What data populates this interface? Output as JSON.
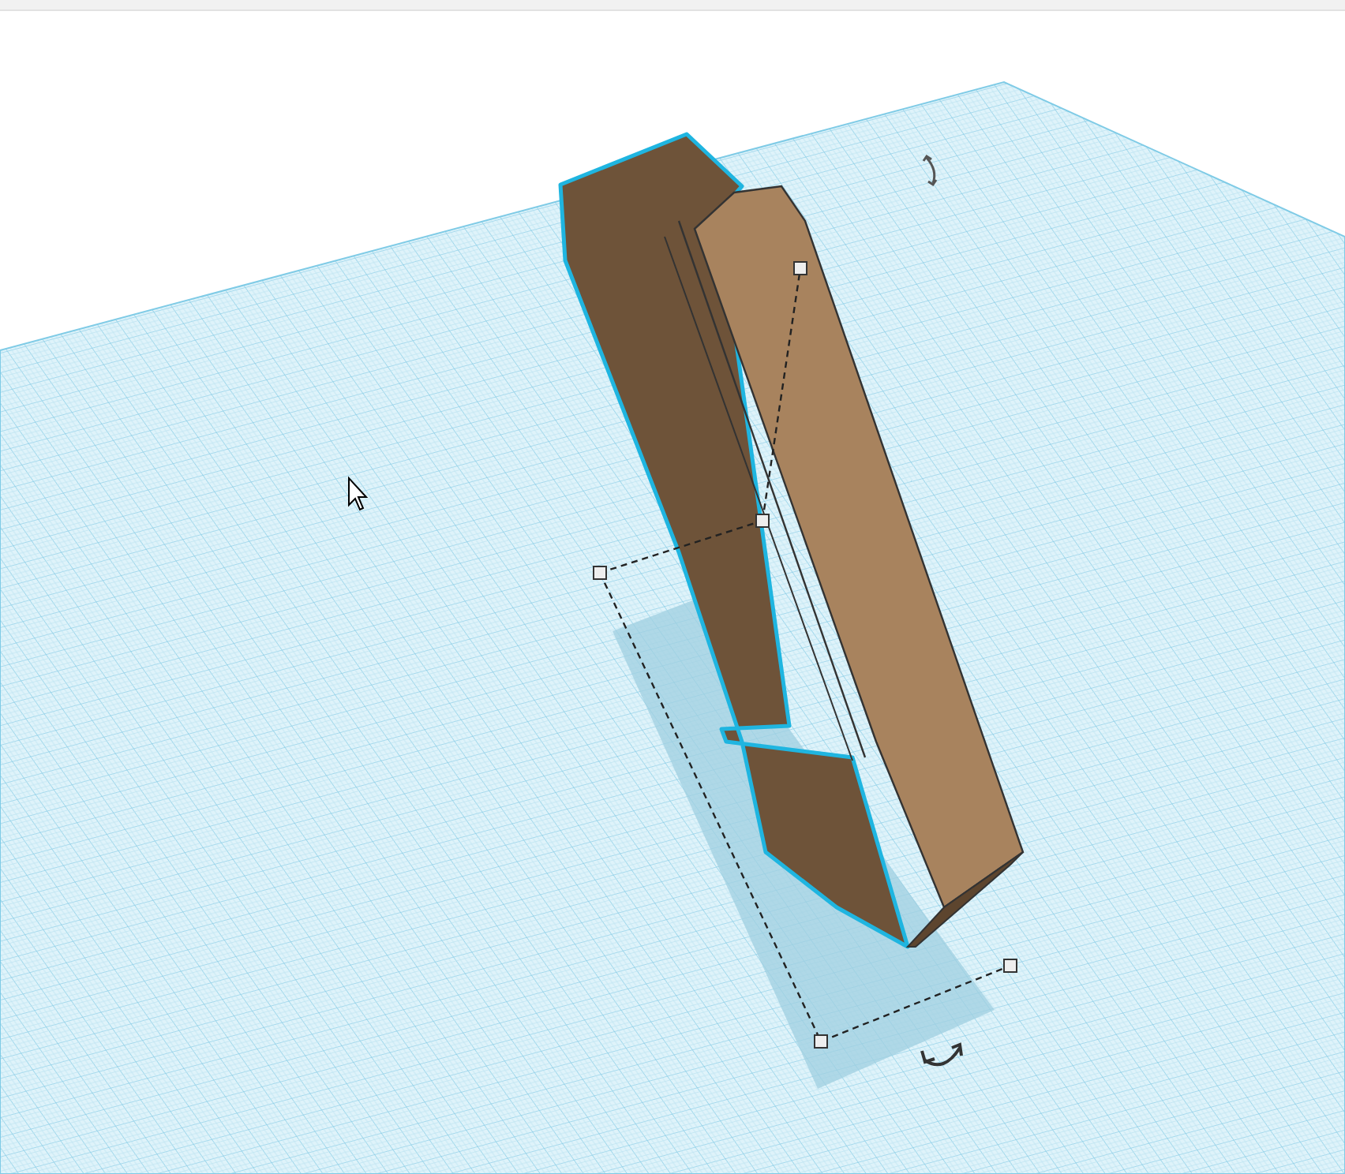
{
  "workplane": {
    "shape": {
      "selected": true
    }
  }
}
